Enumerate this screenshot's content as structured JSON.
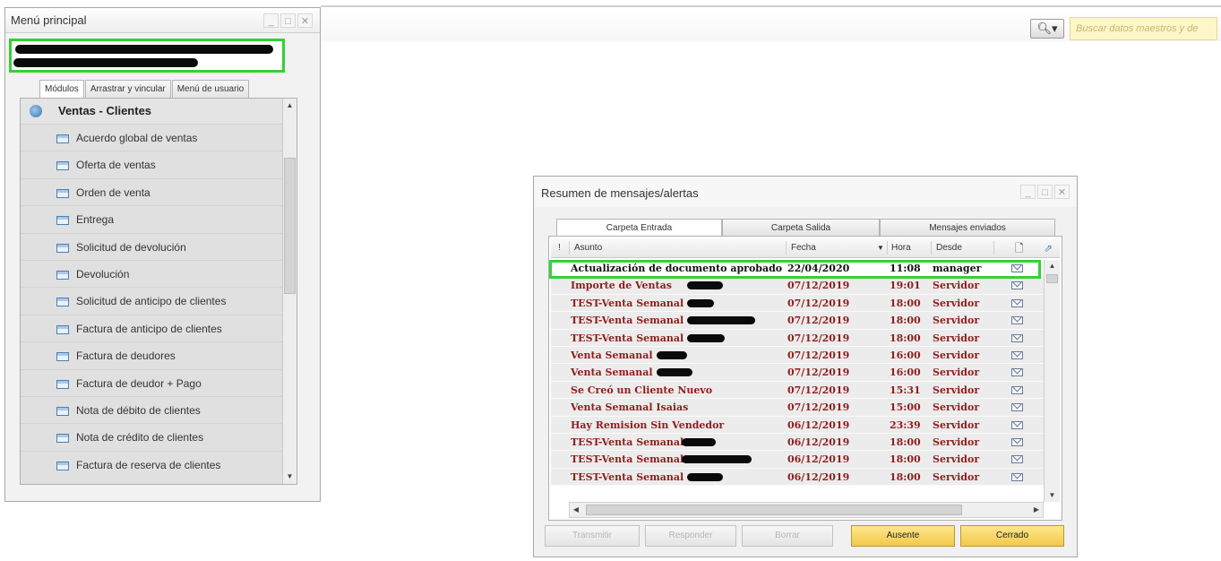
{
  "search": {
    "icon": "search-icon",
    "placeholder": "Buscar datos maestros y de"
  },
  "main_menu": {
    "title": "Menú principal",
    "tabs": [
      "Módulos",
      "Arrastrar y vincular",
      "Menú de usuario"
    ],
    "active_tab": "Módulos",
    "section": "Ventas - Clientes",
    "items": [
      "Acuerdo global de ventas",
      "Oferta de ventas",
      "Orden de venta",
      "Entrega",
      "Solicitud de devolución",
      "Devolución",
      "Solicitud de anticipo de clientes",
      "Factura de anticipo de clientes",
      "Factura de deudores",
      "Factura de deudor + Pago",
      "Nota de débito de clientes",
      "Nota de crédito de clientes",
      "Factura de reserva de clientes"
    ]
  },
  "alerts": {
    "title": "Resumen de mensajes/alertas",
    "tabs": [
      "Carpeta Entrada",
      "Carpeta Salida",
      "Mensajes enviados"
    ],
    "active_tab": "Carpeta Entrada",
    "columns": {
      "priority": "!",
      "asunto": "Asunto",
      "fecha": "Fecha",
      "hora": "Hora",
      "desde": "Desde"
    },
    "rows": [
      {
        "asunto": "Actualización de documento aprobado",
        "fecha": "22/04/2020",
        "hora": "11:08",
        "desde": "manager"
      },
      {
        "asunto": "Importe de Ventas",
        "fecha": "07/12/2019",
        "hora": "19:01",
        "desde": "Servidor"
      },
      {
        "asunto": "TEST-Venta Semanal",
        "fecha": "07/12/2019",
        "hora": "18:00",
        "desde": "Servidor"
      },
      {
        "asunto": "TEST-Venta Semanal",
        "fecha": "07/12/2019",
        "hora": "18:00",
        "desde": "Servidor"
      },
      {
        "asunto": "TEST-Venta Semanal",
        "fecha": "07/12/2019",
        "hora": "18:00",
        "desde": "Servidor"
      },
      {
        "asunto": "Venta Semanal",
        "fecha": "07/12/2019",
        "hora": "16:00",
        "desde": "Servidor"
      },
      {
        "asunto": "Venta Semanal",
        "fecha": "07/12/2019",
        "hora": "16:00",
        "desde": "Servidor"
      },
      {
        "asunto": "Se Creó un Cliente Nuevo",
        "fecha": "07/12/2019",
        "hora": "15:31",
        "desde": "Servidor"
      },
      {
        "asunto": "Venta Semanal Isaias",
        "fecha": "07/12/2019",
        "hora": "15:00",
        "desde": "Servidor"
      },
      {
        "asunto": "Hay Remision Sin Vendedor",
        "fecha": "06/12/2019",
        "hora": "23:39",
        "desde": "Servidor"
      },
      {
        "asunto": "TEST-Venta Semanal",
        "fecha": "06/12/2019",
        "hora": "18:00",
        "desde": "Servidor"
      },
      {
        "asunto": "TEST-Venta Semanal",
        "fecha": "06/12/2019",
        "hora": "18:00",
        "desde": "Servidor"
      },
      {
        "asunto": "TEST-Venta Semanal",
        "fecha": "06/12/2019",
        "hora": "18:00",
        "desde": "Servidor"
      }
    ],
    "buttons": {
      "transmitir": "Transmitir",
      "responder": "Responder",
      "borrar": "Borrar",
      "ausente": "Ausente",
      "cerrado": "Cerrado"
    }
  },
  "colors": {
    "highlight": "#35d035",
    "row_text": "#8e1d1d",
    "active_button": "#f3c94a"
  }
}
